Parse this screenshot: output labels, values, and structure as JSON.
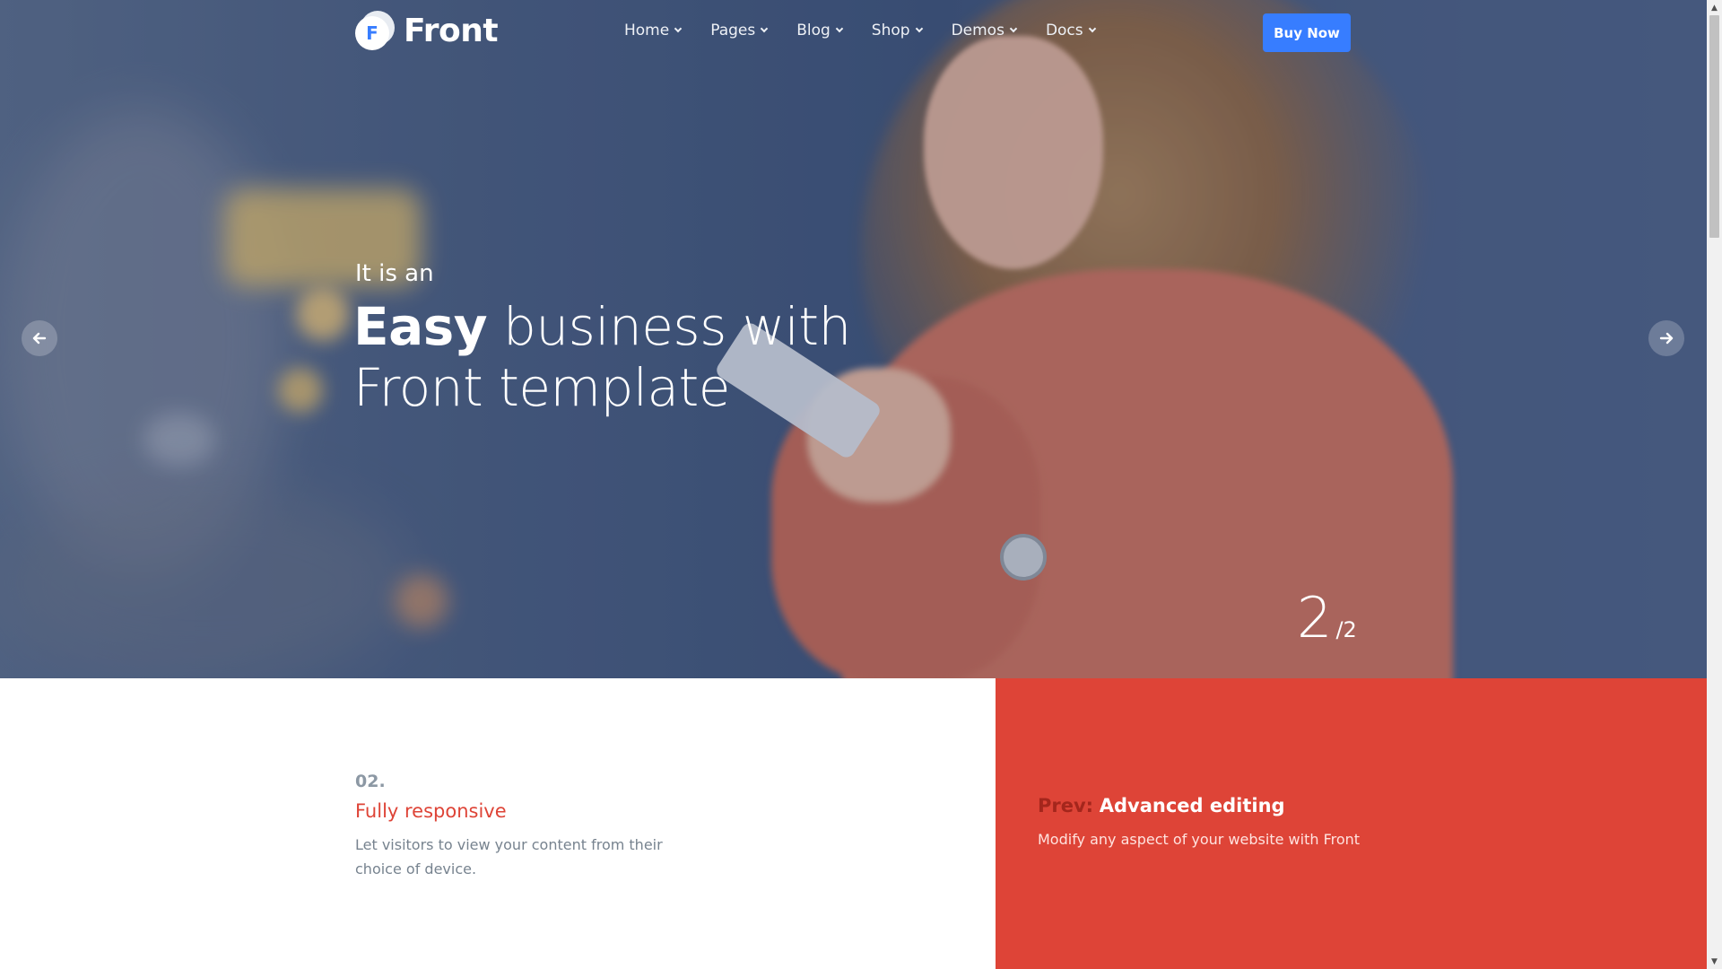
{
  "header": {
    "brand": "Front",
    "logo_letter": "F",
    "nav": [
      {
        "label": "Home"
      },
      {
        "label": "Pages"
      },
      {
        "label": "Blog"
      },
      {
        "label": "Shop"
      },
      {
        "label": "Demos"
      },
      {
        "label": "Docs"
      }
    ],
    "buy_label": "Buy Now"
  },
  "hero": {
    "subtitle": "It is an",
    "title_strong": "Easy",
    "title_rest_line1": " business with",
    "title_line2": "Front template",
    "counter_current": "2",
    "counter_total": "/2",
    "arrow_prev_icon": "arrow-left-icon",
    "arrow_next_icon": "arrow-right-icon"
  },
  "feature": {
    "number": "02.",
    "title": "Fully responsive",
    "description": "Let visitors to view your content from their choice of device."
  },
  "prev": {
    "label": "Prev:",
    "title": "Advanced editing",
    "description": "Modify any aspect of your website with Front"
  },
  "colors": {
    "primary": "#377dff",
    "accent_red": "#de4437",
    "muted_text": "#77838f"
  }
}
